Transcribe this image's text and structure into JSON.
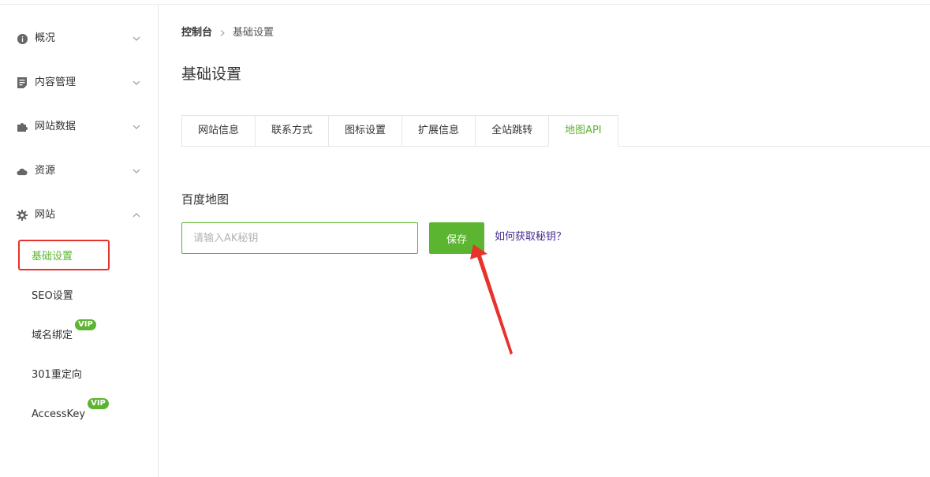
{
  "sidebar": {
    "items": [
      {
        "label": "概况",
        "icon": "info-circle-icon",
        "expanded": false
      },
      {
        "label": "内容管理",
        "icon": "document-icon",
        "expanded": false
      },
      {
        "label": "网站数据",
        "icon": "puzzle-icon",
        "expanded": false
      },
      {
        "label": "资源",
        "icon": "cloud-icon",
        "expanded": false
      },
      {
        "label": "网站",
        "icon": "gear-icon",
        "expanded": true
      }
    ],
    "sub_items": [
      {
        "label": "基础设置",
        "active": true
      },
      {
        "label": "SEO设置"
      },
      {
        "label": "域名绑定",
        "badge": "VIP"
      },
      {
        "label": "301重定向"
      },
      {
        "label": "AccessKey",
        "badge": "VIP"
      }
    ]
  },
  "breadcrumb": {
    "root": "控制台",
    "current": "基础设置"
  },
  "page_title": "基础设置",
  "tabs": [
    {
      "label": "网站信息"
    },
    {
      "label": "联系方式"
    },
    {
      "label": "图标设置"
    },
    {
      "label": "扩展信息"
    },
    {
      "label": "全站跳转"
    },
    {
      "label": "地图API",
      "active": true
    }
  ],
  "baidu_map": {
    "section_title": "百度地图",
    "input_placeholder": "请输入AK秘钥",
    "input_value": "",
    "save_label": "保存",
    "help_link": "如何获取秘钥？"
  },
  "colors": {
    "accent": "#5cb531",
    "highlight": "#e8322c",
    "link": "#4a2b8f"
  }
}
